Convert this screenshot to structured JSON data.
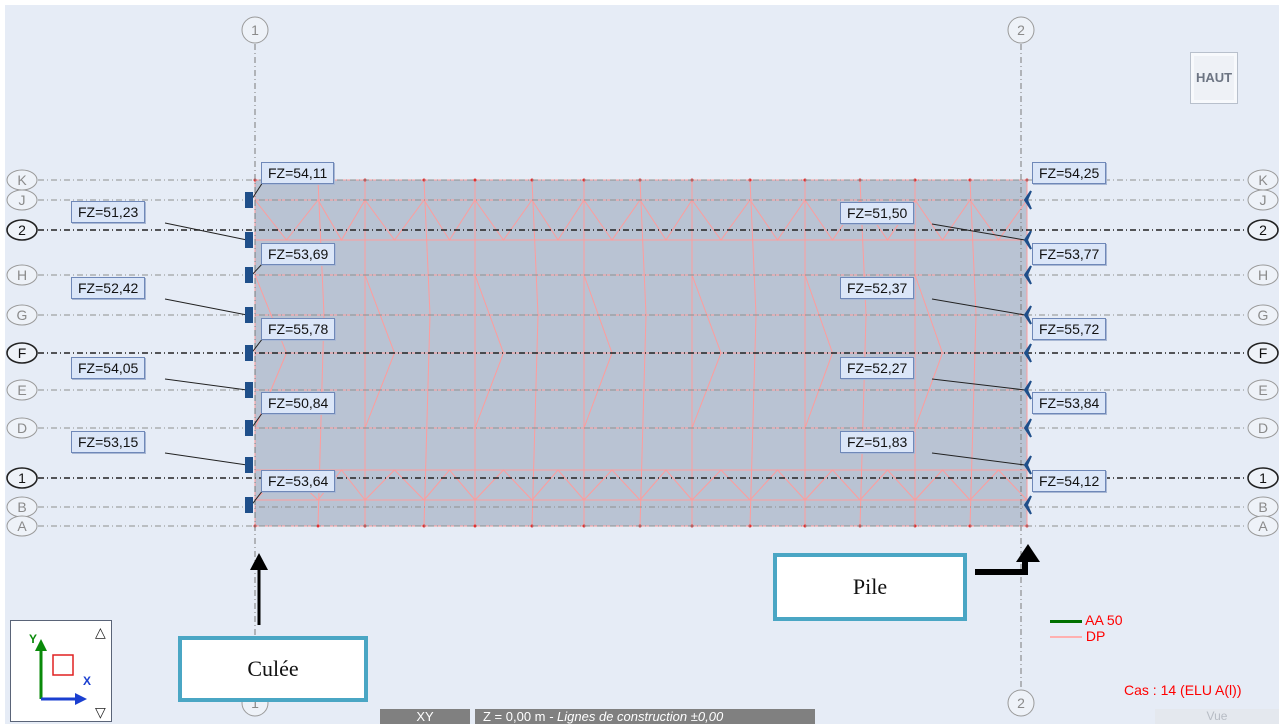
{
  "view": {
    "haut_button": "HAUT",
    "case_label": "Cas : 14 (ELU A(l))",
    "legend": [
      {
        "label": "AA 50",
        "color": "#007000"
      },
      {
        "label": "DP",
        "color": "#ffb0b0"
      }
    ]
  },
  "grid": {
    "columns": [
      "1",
      "2"
    ],
    "rows": [
      "K",
      "J",
      "2",
      "H",
      "G",
      "F",
      "E",
      "D",
      "1",
      "B",
      "A"
    ]
  },
  "reactions": {
    "culee_right": [
      "FZ=54,11",
      "FZ=53,69",
      "FZ=55,78",
      "FZ=50,84",
      "FZ=53,64"
    ],
    "culee_left": [
      "FZ=51,23",
      "FZ=52,42",
      "FZ=54,05",
      "FZ=53,15"
    ],
    "pile_right": [
      "FZ=54,25",
      "FZ=53,77",
      "FZ=55,72",
      "FZ=53,84",
      "FZ=54,12"
    ],
    "pile_left": [
      "FZ=51,50",
      "FZ=52,37",
      "FZ=52,27",
      "FZ=51,83"
    ]
  },
  "annotations": {
    "culee": "Culée",
    "pile": "Pile"
  },
  "axes": {
    "y_label": "Y",
    "x_label": "X",
    "up_glyph": "△",
    "down_glyph": "▽"
  },
  "status": {
    "plane": "XY",
    "z_level": "Z = 0,00 m",
    "z_detail": " - Lignes de construction ±0,00",
    "view_label": "Vue"
  },
  "colors": {
    "slab": "#b9c3d3",
    "mesh": "#ff9c9c",
    "support": "#1f4f8a",
    "accent": "#4aa6c4"
  }
}
